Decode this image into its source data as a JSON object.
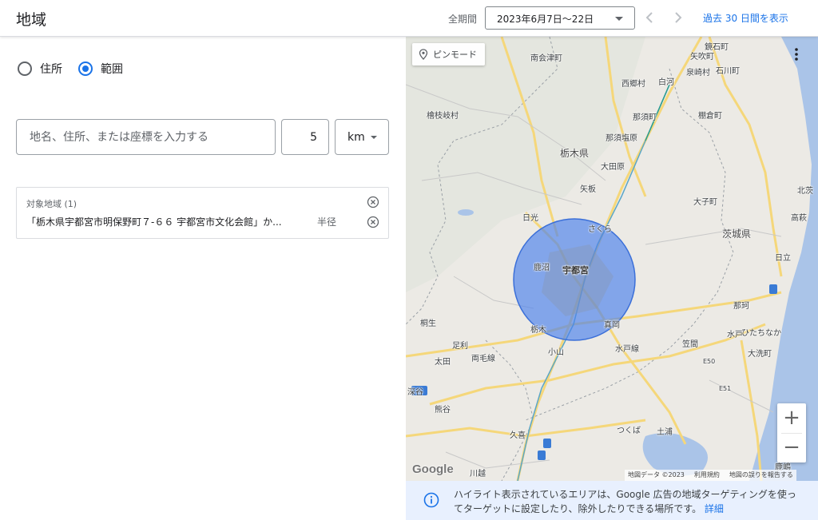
{
  "header": {
    "title": "地域",
    "period_label": "全期間",
    "date_range": "2023年6月7日〜22日",
    "show_30_days": "過去 30 日間を表示"
  },
  "mode": {
    "address_label": "住所",
    "radius_label": "範囲",
    "selected": "radius"
  },
  "search": {
    "placeholder": "地名、住所、または座標を入力する",
    "radius_value": "5",
    "unit": "km"
  },
  "targets": {
    "header": "対象地域 (1)",
    "items": [
      {
        "label": "「栃木県宇都宮市明保野町７-６６ 宇都宮市文化会館」か...",
        "type": "半径"
      }
    ]
  },
  "map": {
    "pin_mode_label": "ピンモード",
    "zoom_in": "+",
    "zoom_out": "−",
    "google": "Google",
    "attribution": [
      "地図データ ©2023",
      "利用規約",
      "地図の誤りを報告する"
    ],
    "info_text": "ハイライト表示されているエリアは、Google 広告の地域ターゲティングを使ってターゲットに設定したり、除外したりできる場所です。",
    "info_link": "詳細",
    "labels": {
      "minamiaizu": "南会津町",
      "kagamiishi": "鏡石町",
      "yabuki": "矢吹町",
      "izumizaki": "泉崎村",
      "ishikawa": "石川町",
      "nishigo": "西郷村",
      "shirakawa": "白河",
      "hinoemata": "檜枝岐村",
      "nasushiobara": "那須塩原",
      "nasu": "那須町",
      "tanagura": "棚倉町",
      "tochigi_pref": "栃木県",
      "otawara": "大田原",
      "yaita": "矢板",
      "daigo": "大子町",
      "kitaibaraki": "北茨",
      "nikko": "日光",
      "sakura": "さくら",
      "takahagi": "高萩",
      "ibaraki_pref": "茨城県",
      "utsunomiya": "宇都宮",
      "kanuma": "鹿沼",
      "hitachi": "日立",
      "naka": "那珂",
      "kiryu": "桐生",
      "tochigi_city": "栃木",
      "moka": "真岡",
      "mito": "水戸",
      "hitachinaka": "ひたちなか",
      "ashikaga": "足利",
      "ryomo": "両毛線",
      "kasama": "笠間",
      "oyama": "小山",
      "mitosen": "水戸線",
      "oarai": "大洗町",
      "ota": "太田",
      "fukaya": "深谷",
      "kumagaya": "熊谷",
      "kuki": "久喜",
      "tsukuba": "つくば",
      "tsuchiura": "土浦",
      "kawagoe": "川越",
      "kashima": "鹿嶋",
      "tohoku_shinkansen": "東北新幹線",
      "e50": "E50",
      "e51": "E51"
    }
  }
}
